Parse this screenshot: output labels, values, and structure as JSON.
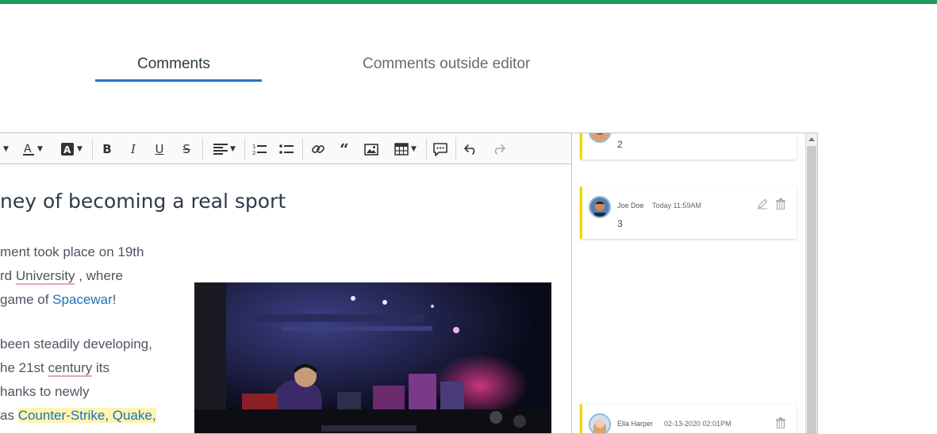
{
  "tabs": [
    {
      "label": "Comments",
      "active": true
    },
    {
      "label": "Comments outside editor",
      "active": false
    }
  ],
  "colors": {
    "accent_bar": "#1e9a5f",
    "tab_underline": "#1f78c1",
    "link": "#1f6fc1",
    "comment_marker": "#f2d900"
  },
  "toolbar": {
    "icons": [
      "font-size-dropdown",
      "font-color-dropdown",
      "font-background-dropdown",
      "bold",
      "italic",
      "underline",
      "strikethrough",
      "alignment-dropdown",
      "numbered-list",
      "bulleted-list",
      "link",
      "block-quote",
      "insert-image",
      "insert-table",
      "comment",
      "undo",
      "redo"
    ]
  },
  "document": {
    "heading": "ney of becoming a real sport",
    "p1": {
      "line1": "ment took place on 19th",
      "line2_pre": "rd ",
      "line2_spell": "University",
      "line2_post": " , where",
      "line3_pre": "game of ",
      "line3_link": "Spacewar",
      "line3_post": "!"
    },
    "p2": {
      "line1": "been steadily developing,",
      "line2_pre": "he 21st ",
      "line2_spell": "century",
      "line2_post": " its",
      "line3": "hanks to newly",
      "line4_pre": "as ",
      "line4_link1": "Counter-Strike",
      "line4_sep": ", ",
      "line4_link2": "Quake",
      "line4_post": ","
    }
  },
  "comments": [
    {
      "text": "2"
    },
    {
      "author": "Joe Doe",
      "date": "Today 11:59AM",
      "text": "3"
    },
    {
      "author": "Ella Harper",
      "date": "02-13-2020 02:01PM"
    }
  ]
}
